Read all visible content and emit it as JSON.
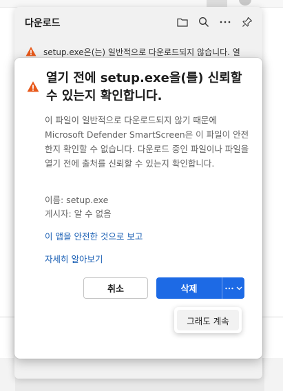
{
  "panel": {
    "title": "다운로드",
    "item_text": "setup.exe은(는) 일반적으로 다운로드되지 않습니다. 열"
  },
  "dialog": {
    "title": "열기 전에 setup.exe을(를) 신뢰할 수 있는지 확인합니다.",
    "body": "이 파일이 일반적으로 다운로드되지 않기 때문에 Microsoft Defender SmartScreen은 이 파일이 안전한지 확인할 수 없습니다. 다운로드 중인 파일이나 파일을 열기 전에 출처를 신뢰할 수 있는지 확인합니다.",
    "name_line": "이름: setup.exe",
    "publisher_line": "게시자: 알 수 없음",
    "report_link": "이 앱을 안전한 것으로 보고",
    "learn_more_link": "자세히 알아보기",
    "cancel_label": "취소",
    "delete_label": "삭제",
    "menu_keep_label": "그래도 계속"
  },
  "colors": {
    "accent": "#1d6ae5",
    "link": "#1a5fb4",
    "warning": "#e8591a"
  },
  "icons": [
    "folder-icon",
    "search-icon",
    "more-icon",
    "pin-icon",
    "warning-icon",
    "chevron-down-icon"
  ]
}
